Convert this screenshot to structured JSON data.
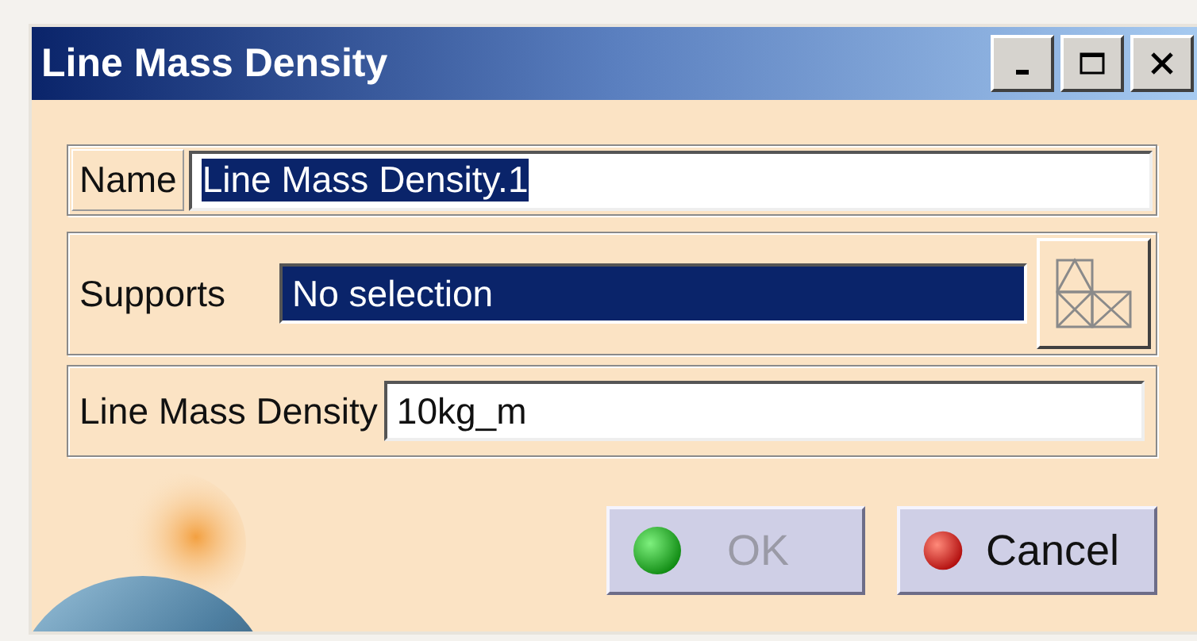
{
  "window": {
    "title": "Line Mass Density"
  },
  "name_row": {
    "label": "Name",
    "value": "Line Mass Density.1",
    "highlighted": true
  },
  "supports_row": {
    "label": "Supports",
    "value": "No selection",
    "highlighted": true
  },
  "density_row": {
    "label": "Line Mass Density",
    "value": "10kg_m",
    "highlighted": false
  },
  "buttons": [
    {
      "label": "OK",
      "kind": "ok",
      "disabled": true
    },
    {
      "label": "Cancel",
      "kind": "cancel",
      "disabled": false
    }
  ]
}
